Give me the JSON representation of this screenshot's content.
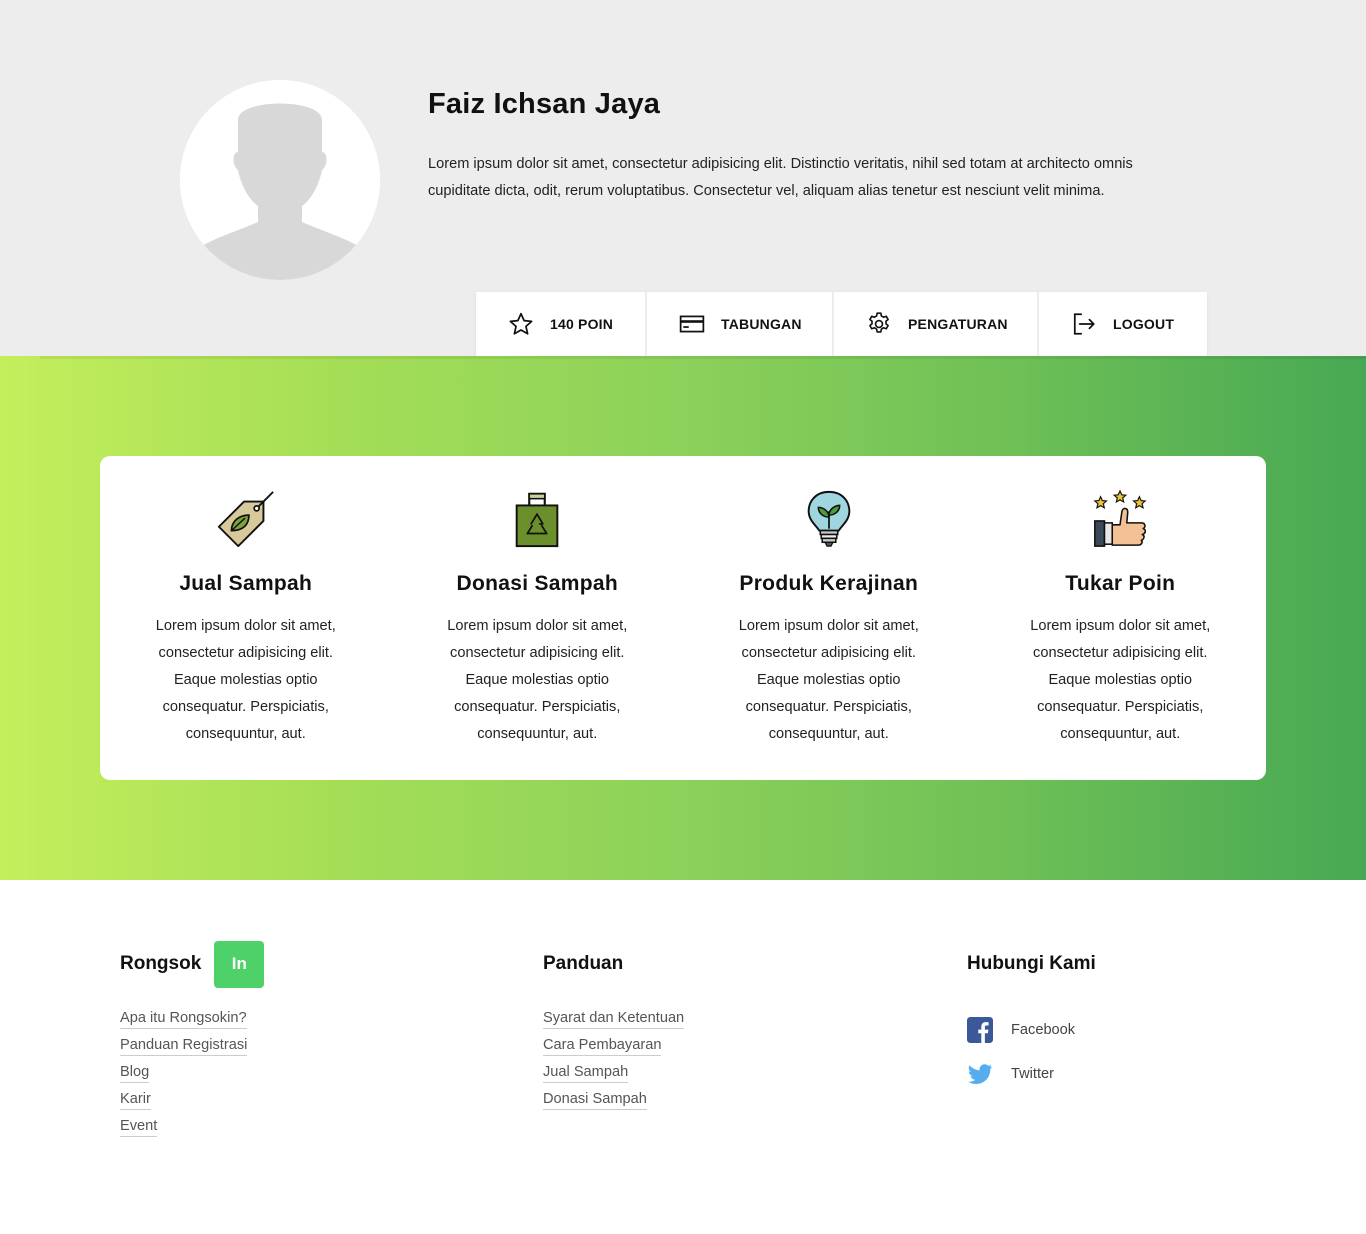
{
  "profile": {
    "name": "Faiz Ichsan Jaya",
    "bio": "Lorem ipsum dolor sit amet, consectetur adipisicing elit. Distinctio veritatis, nihil sed totam at architecto omnis cupiditate dicta, odit, rerum voluptatibus. Consectetur vel, aliquam alias tenetur est nesciunt velit minima.",
    "menu": [
      {
        "label": "140 POIN",
        "icon": "star-icon"
      },
      {
        "label": "TABUNGAN",
        "icon": "credit-card-icon"
      },
      {
        "label": "PENGATURAN",
        "icon": "gear-icon"
      },
      {
        "label": "LOGOUT",
        "icon": "logout-icon"
      }
    ]
  },
  "features": [
    {
      "title": "Jual Sampah",
      "icon": "leaf-tag-icon",
      "desc": "Lorem ipsum dolor sit amet, consectetur adipisicing elit. Eaque molestias optio consequatur. Perspiciatis, consequuntur, aut."
    },
    {
      "title": "Donasi Sampah",
      "icon": "recycle-bag-icon",
      "desc": "Lorem ipsum dolor sit amet, consectetur adipisicing elit. Eaque molestias optio consequatur. Perspiciatis, consequuntur, aut."
    },
    {
      "title": "Produk Kerajinan",
      "icon": "plant-bulb-icon",
      "desc": "Lorem ipsum dolor sit amet, consectetur adipisicing elit. Eaque molestias optio consequatur. Perspiciatis, consequuntur, aut."
    },
    {
      "title": "Tukar Poin",
      "icon": "thumbs-up-stars-icon",
      "desc": "Lorem ipsum dolor sit amet, consectetur adipisicing elit. Eaque molestias optio consequatur. Perspiciatis, consequuntur, aut."
    }
  ],
  "footer": {
    "brand": {
      "name": "Rongsok",
      "badge": "In"
    },
    "brand_links": [
      "Apa itu Rongsokin?",
      "Panduan Registrasi",
      "Blog",
      "Karir",
      "Event"
    ],
    "guide": {
      "title": "Panduan",
      "links": [
        "Syarat dan Ketentuan",
        "Cara Pembayaran",
        "Jual Sampah",
        "Donasi Sampah"
      ]
    },
    "contact": {
      "title": "Hubungi Kami",
      "items": [
        {
          "label": "Facebook",
          "icon": "facebook-icon"
        },
        {
          "label": "Twitter",
          "icon": "twitter-icon"
        }
      ]
    }
  },
  "colors": {
    "gradient_start": "#c4ee5c",
    "gradient_end": "#47a853",
    "brand_badge": "#4fd169",
    "header_bg": "#ededed"
  }
}
